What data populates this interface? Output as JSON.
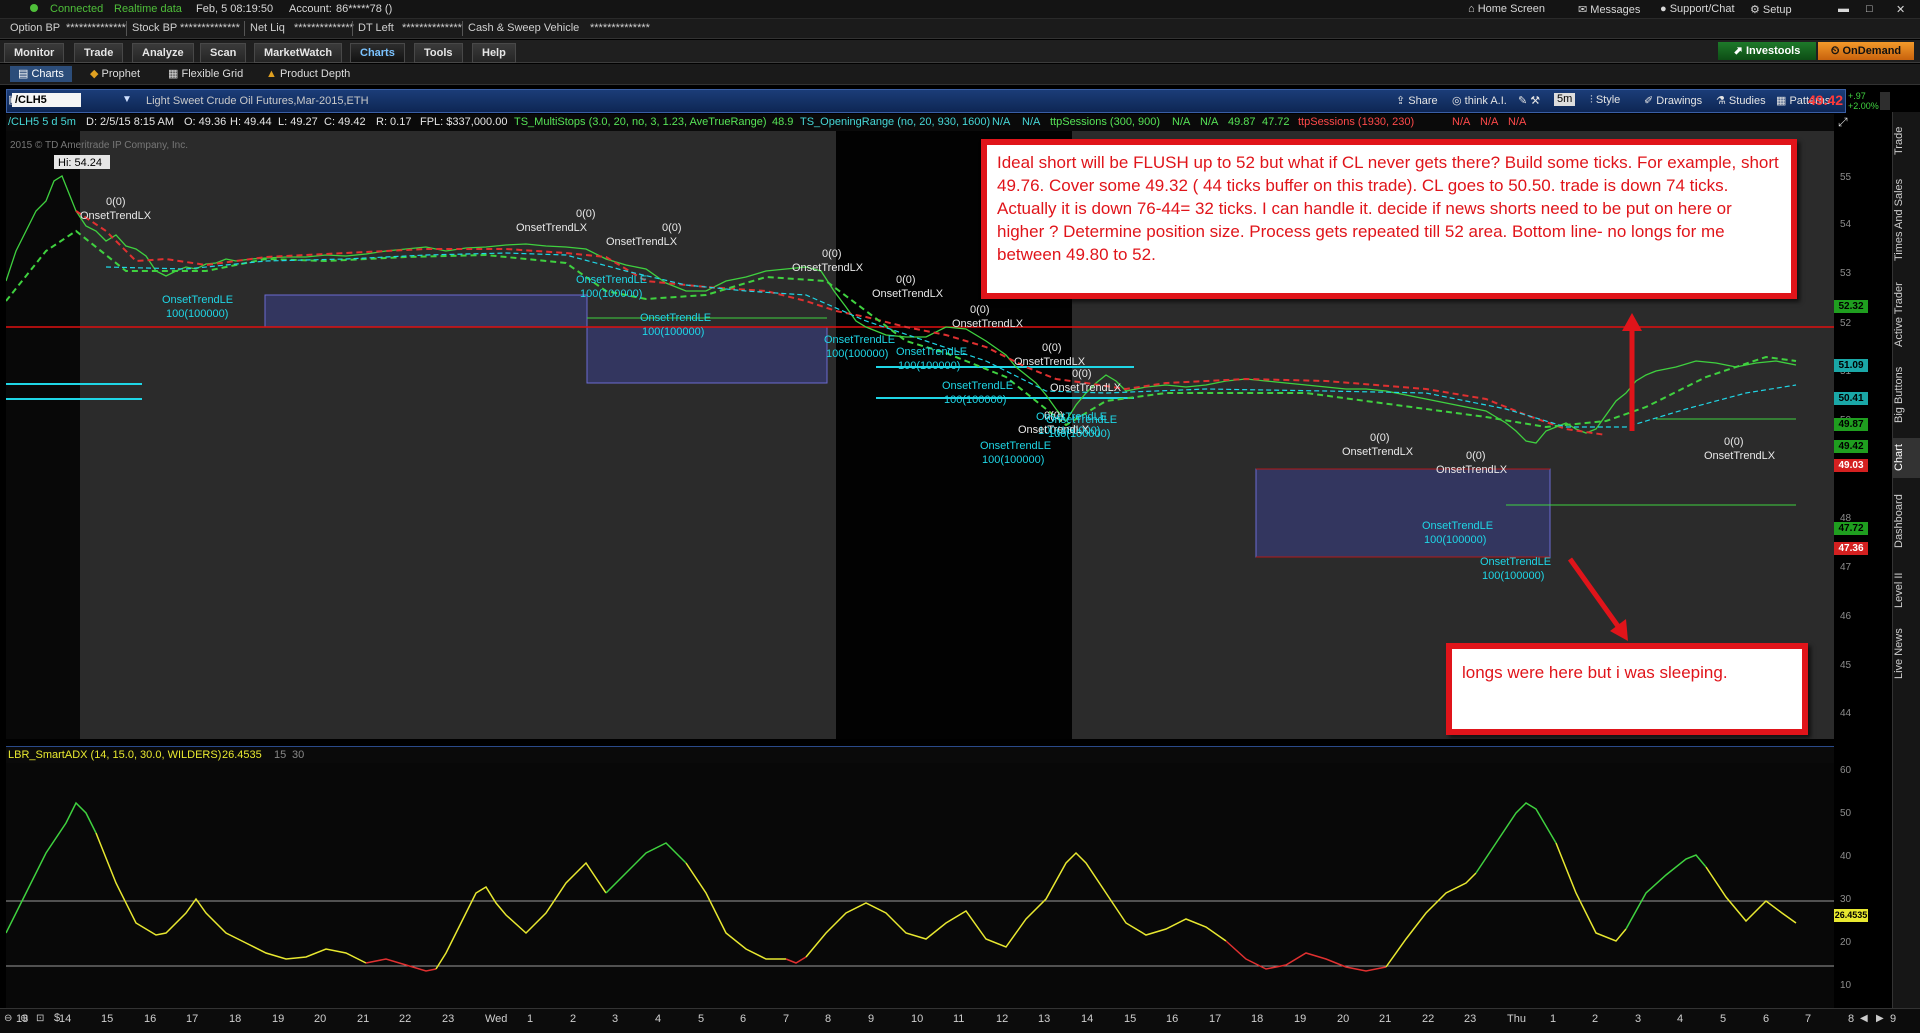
{
  "status": {
    "connected": "Connected",
    "realtime": "Realtime data",
    "datetime": "Feb, 5  08:19:50",
    "account_label": "Account:",
    "account_value": "86*****78 ()",
    "home_screen": "Home Screen",
    "messages": "Messages",
    "support_chat": "Support/Chat",
    "setup": "Setup"
  },
  "account_bar": {
    "option_bp": "Option BP",
    "option_bp_val": "**************",
    "stock_bp": "Stock BP",
    "stock_bp_val": "**************",
    "net_liq": "Net Liq",
    "net_liq_val": "**************",
    "dt_left": "DT Left",
    "dt_left_val": "**************",
    "cash_sweep": "Cash & Sweep Vehicle",
    "cash_sweep_val": "**************"
  },
  "nav_tabs": [
    "Monitor",
    "Trade",
    "Analyze",
    "Scan",
    "MarketWatch",
    "Charts",
    "Tools",
    "Help"
  ],
  "active_tab": "Charts",
  "brand": {
    "investools": "Investools",
    "ondemand": "OnDemand"
  },
  "subnav": [
    "Charts",
    "Prophet",
    "Flexible Grid",
    "Product Depth"
  ],
  "chart_header": {
    "symbol": "/CLH5",
    "description": "Light Sweet Crude Oil Futures,Mar-2015,ETH",
    "buttons": [
      "Share",
      "think A.I.",
      "5m",
      "Style",
      "Drawings",
      "Studies",
      "Patterns"
    ],
    "last_price": "49.42",
    "change_up": "+.97",
    "change_pct": "+2.00%"
  },
  "info_row": {
    "symbol_period": "/CLH5 5 d 5m",
    "date": "D: 2/5/15 8:15 AM",
    "open": "O: 49.36",
    "high": "H: 49.44",
    "low": "L: 49.27",
    "close": "C: 49.42",
    "range": "R: 0.17",
    "fpl": "FPL: $337,000.00",
    "multistops": "TS_MultiStops (3.0, 20, no, 3, 1.23, AveTrueRange)",
    "multistops_val": "48.9",
    "openingrange": "TS_OpeningRange (no, 20, 930, 1600)",
    "na1": "N/A",
    "na2": "N/A",
    "ttp1": "ttpSessions (300, 900)",
    "na3": "N/A",
    "na4": "N/A",
    "v1": "49.87",
    "v2": "47.72",
    "ttp2": "ttpSessions (1930, 230)",
    "na5": "N/A",
    "na6": "N/A",
    "na7": "N/A"
  },
  "copyright": "2015 © TD Ameritrade IP Company, Inc.",
  "hi_label": "Hi: 54.24",
  "price_axis": [
    "55",
    "54",
    "53",
    "52",
    "51",
    "50",
    "49",
    "48",
    "47",
    "46",
    "45",
    "44"
  ],
  "price_badges": [
    {
      "text": "52.32",
      "color": "#1f9e1f"
    },
    {
      "text": "51.09",
      "color": "#1aa7a7"
    },
    {
      "text": "50.41",
      "color": "#1aa7a7"
    },
    {
      "text": "49.87",
      "color": "#1f9e1f"
    },
    {
      "text": "49.42",
      "color": "#1f9e1f"
    },
    {
      "text": "49.03",
      "color": "#d42020"
    },
    {
      "text": "47.72",
      "color": "#1f9e1f"
    },
    {
      "text": "47.36",
      "color": "#d42020"
    }
  ],
  "signals": [
    {
      "label": "0(0)",
      "kind": "lx"
    },
    {
      "label": "OnsetTrendLX",
      "kind": "lx"
    },
    {
      "label": "OnsetTrendLE",
      "kind": "le"
    },
    {
      "label": "100(100000)",
      "kind": "le"
    }
  ],
  "annotation_main": "Ideal short will be FLUSH up to 52 but what if CL never gets there? Build some ticks. For example, short 49.76. Cover some 49.32 ( 44 ticks buffer on this trade). CL goes to 50.50. trade is down 74 ticks. Actually it is down 76-44= 32 ticks. I can handle it. decide if news shorts need to be put on here or higher ? Determine position size. Process gets repeated till 52 area. Bottom line- no longs for me between 49.80 to 52.",
  "annotation_long": "longs were here but i was sleeping.",
  "lower_study": {
    "name": "LBR_SmartADX (14, 15.0, 30.0, WILDERS)",
    "value": "26.4535",
    "p1": "15",
    "p2": "30",
    "axis": [
      "60",
      "50",
      "40",
      "30",
      "20",
      "10"
    ]
  },
  "x_axis": [
    "13",
    "14",
    "15",
    "16",
    "17",
    "18",
    "19",
    "20",
    "21",
    "22",
    "23",
    "Wed",
    "1",
    "2",
    "3",
    "4",
    "5",
    "6",
    "7",
    "8",
    "9",
    "10",
    "11",
    "12",
    "13",
    "14",
    "15",
    "16",
    "17",
    "18",
    "19",
    "20",
    "21",
    "22",
    "23",
    "Thu",
    "1",
    "2",
    "3",
    "4",
    "5",
    "6",
    "7",
    "8",
    "9"
  ],
  "right_tabs": [
    "Trade",
    "Times And Sales",
    "Active Trader",
    "Big Buttons",
    "Chart",
    "Dashboard",
    "Level II",
    "Live News"
  ],
  "colors": {
    "annotation": "#e0141a",
    "up": "#3fd13f",
    "down": "#e03030",
    "cyan": "#1fd6e6"
  }
}
